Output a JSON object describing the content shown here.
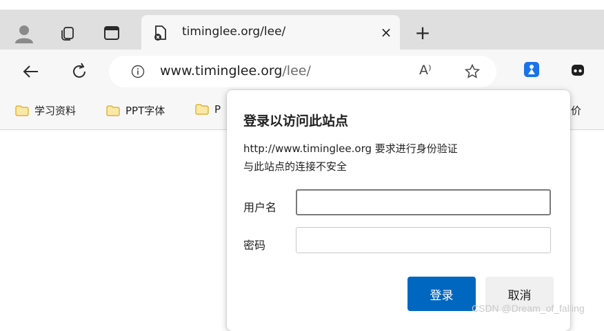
{
  "browser": {
    "tab": {
      "title": "timinglee.org/lee/",
      "close_glyph": "×"
    },
    "new_tab_glyph": "+",
    "address": {
      "host": "www.timinglee.org",
      "path": "/lee/"
    },
    "read_aloud_glyph": "A⁾"
  },
  "bookmarks": [
    {
      "label": "学习资料"
    },
    {
      "label": "PPT字体"
    },
    {
      "label": "P"
    },
    {
      "label": "价"
    }
  ],
  "dialog": {
    "title": "登录以访问此站点",
    "message_line1": "http://www.timinglee.org 要求进行身份验证",
    "message_line2": "与此站点的连接不安全",
    "username_label": "用户名",
    "username_value": "",
    "password_label": "密码",
    "password_value": "",
    "login_label": "登录",
    "cancel_label": "取消"
  },
  "watermark": "CSDN @Dream_of_falling",
  "colors": {
    "accent": "#0067c0",
    "tabbar": "#dfdfdf",
    "toolbar": "#f7f7f7",
    "folder": "#f5c542"
  }
}
